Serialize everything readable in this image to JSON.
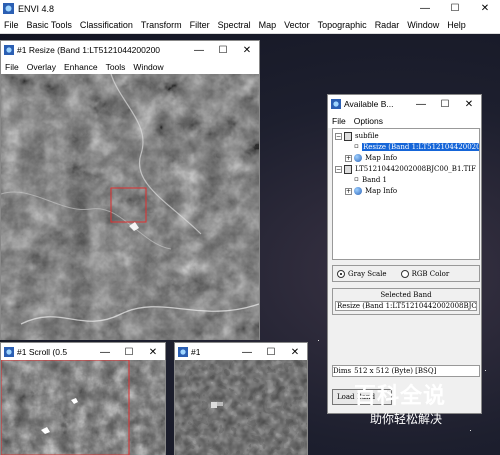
{
  "app": {
    "title": "ENVI 4.8",
    "menu": [
      "File",
      "Basic Tools",
      "Classification",
      "Transform",
      "Filter",
      "Spectral",
      "Map",
      "Vector",
      "Topographic",
      "Radar",
      "Window",
      "Help"
    ]
  },
  "window_controls": {
    "minimize": "—",
    "maximize": "☐",
    "close": "✕"
  },
  "image_window": {
    "title": "#1 Resize (Band 1:LT5121044200200",
    "menu": [
      "File",
      "Overlay",
      "Enhance",
      "Tools",
      "Window"
    ]
  },
  "scroll_window": {
    "title": "#1 Scroll (0.5"
  },
  "zoom_window": {
    "title": "#1"
  },
  "available_bands": {
    "title": "Available B...",
    "menu": [
      "File",
      "Options"
    ],
    "tree": {
      "file1": "subfile",
      "band1_selected": "Resize (Band 1:LT51210442002008BJC00_B1.TIF)",
      "mapinfo1": "Map Info",
      "file2": "LT51210442002008BJC00_B1.TIF",
      "band1": "Band 1",
      "mapinfo2": "Map Info",
      "expand": "+",
      "collapse": "−"
    },
    "mode_gray": "Gray Scale",
    "mode_rgb": "RGB Color",
    "selected_mode": "gray",
    "selected_band_label": "Selected Band",
    "selected_band_value": "Resize (Band 1:LT51210442002008BJC00_B1.TIF)",
    "dims_label": "Dims",
    "dims_value": "512 x 512 (Byte) [BSQ]",
    "load_button": "Load Band"
  },
  "watermark": {
    "logo": "百科全说",
    "sub": "助你轻松解决"
  },
  "colors": {
    "selection_blue": "#1565d8",
    "roi_red": "#e03030",
    "titlebar_white": "#ffffff"
  }
}
